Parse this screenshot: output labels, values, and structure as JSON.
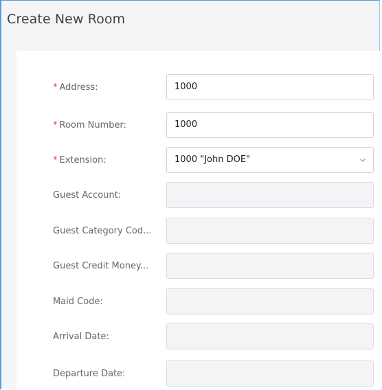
{
  "dialog": {
    "title": "Create New Room"
  },
  "form": {
    "fields": [
      {
        "label": "Address:",
        "required": true,
        "value": "1000",
        "type": "text",
        "enabled": true
      },
      {
        "label": "Room Number:",
        "required": true,
        "value": "1000",
        "type": "text",
        "enabled": true
      },
      {
        "label": "Extension:",
        "required": true,
        "value": "1000 \"John DOE\"",
        "type": "select",
        "enabled": true
      },
      {
        "label": "Guest Account:",
        "required": false,
        "value": "",
        "type": "text",
        "enabled": false
      },
      {
        "label": "Guest Category Cod...",
        "required": false,
        "value": "",
        "type": "text",
        "enabled": false
      },
      {
        "label": "Guest Credit Money...",
        "required": false,
        "value": "",
        "type": "text",
        "enabled": false
      },
      {
        "label": "Maid Code:",
        "required": false,
        "value": "",
        "type": "text",
        "enabled": false
      },
      {
        "label": "Arrival Date:",
        "required": false,
        "value": "",
        "type": "text",
        "enabled": false
      },
      {
        "label": "Departure Date:",
        "required": false,
        "value": "",
        "type": "text",
        "enabled": false
      }
    ]
  },
  "icons": {
    "required_marker": "*",
    "select_chevron": "chevron-down-icon"
  },
  "colors": {
    "required": "#e64545",
    "frame_border": "#5b9bd5"
  }
}
